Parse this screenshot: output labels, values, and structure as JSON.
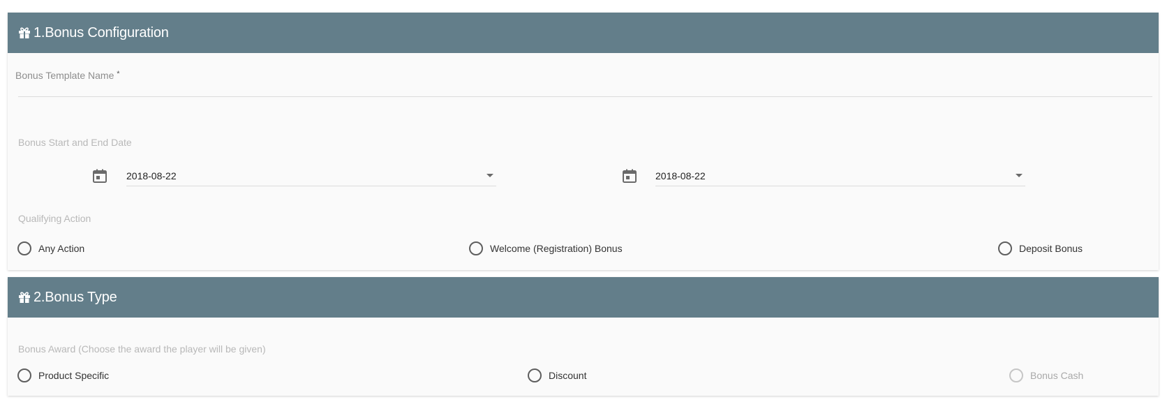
{
  "section1": {
    "title": "1.Bonus Configuration",
    "icon": "gift-icon",
    "template_name_label": "Bonus Template Name",
    "template_name_required": "*",
    "template_name_value": "",
    "dates_label": "Bonus Start and End Date",
    "start_date": "2018-08-22",
    "end_date": "2018-08-22",
    "qualifying_label": "Qualifying Action",
    "qualifying_options": [
      "Any Action",
      "Welcome (Registration) Bonus",
      "Deposit Bonus"
    ]
  },
  "section2": {
    "title": "2.Bonus Type",
    "icon": "gift-icon",
    "award_label": "Bonus Award (Choose the award the player will be given)",
    "award_options": [
      "Product Specific",
      "Discount",
      "Bonus Cash"
    ],
    "disabled_option": "Bonus Cash"
  },
  "colors": {
    "header_bg": "#637e8a",
    "card_bg": "#fafafa",
    "muted_label": "#b8b8b8"
  }
}
